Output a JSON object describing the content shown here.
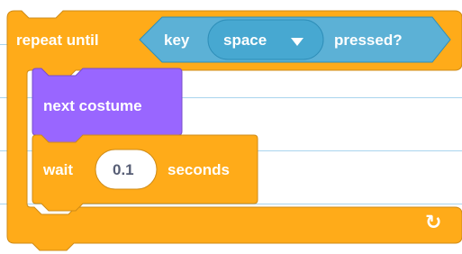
{
  "script": {
    "repeat_until": {
      "label": "repeat until",
      "condition": {
        "key_label": "key",
        "key_value": "space",
        "pressed_label": "pressed?"
      },
      "loop_icon": "loop-arrow-icon"
    },
    "next_costume": {
      "label": "next costume"
    },
    "wait": {
      "label": "wait",
      "value": "0.1",
      "unit": "seconds"
    }
  },
  "colors": {
    "control": "#ffab19",
    "control_border": "#cf8b17",
    "sensing": "#5cb1d6",
    "sensing_border": "#2e8eb8",
    "sensing_dark": "#47a8d1",
    "looks": "#9966ff",
    "looks_border": "#774dcb",
    "notebook_line": "#a9d4ee"
  }
}
